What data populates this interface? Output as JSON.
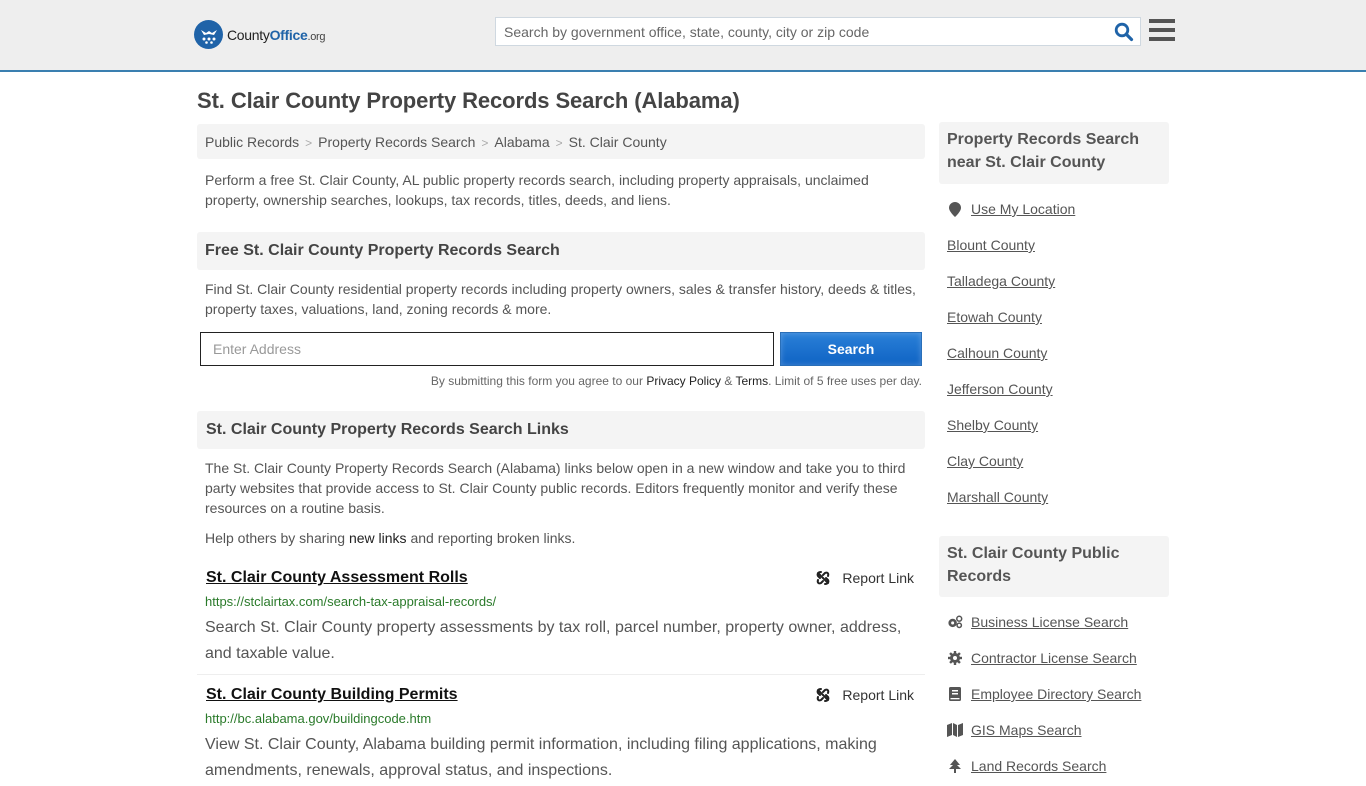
{
  "header": {
    "logo": {
      "county": "County",
      "office": "Office",
      "org": ".org"
    },
    "search_placeholder": "Search by government office, state, county, city or zip code",
    "search_value": ""
  },
  "page_title": "St. Clair County Property Records Search (Alabama)",
  "breadcrumb": [
    "Public Records",
    "Property Records Search",
    "Alabama",
    "St. Clair County"
  ],
  "intro": "Perform a free St. Clair County, AL public property records search, including property appraisals, unclaimed property, ownership searches, lookups, tax records, titles, deeds, and liens.",
  "free_search": {
    "heading": "Free St. Clair County Property Records Search",
    "description": "Find St. Clair County residential property records including property owners, sales & transfer history, deeds & titles, property taxes, valuations, land, zoning records & more.",
    "address_placeholder": "Enter Address",
    "address_value": "",
    "button_label": "Search",
    "disclaimer": {
      "prefix": "By submitting this form you agree to our ",
      "privacy": "Privacy Policy",
      "amp": " & ",
      "terms": "Terms",
      "suffix": ". Limit of 5 free uses per day."
    }
  },
  "links_section": {
    "heading": "St. Clair County Property Records Search Links",
    "description": "The St. Clair County Property Records Search (Alabama) links below open in a new window and take you to third party websites that provide access to St. Clair County public records. Editors frequently monitor and verify these resources on a routine basis.",
    "help": {
      "prefix": "Help others by sharing ",
      "link": "new links",
      "suffix": " and reporting broken links."
    },
    "report_label": "Report Link",
    "items": [
      {
        "title": "St. Clair County Assessment Rolls",
        "url": "https://stclairtax.com/search-tax-appraisal-records/",
        "description": "Search St. Clair County property assessments by tax roll, parcel number, property owner, address, and taxable value."
      },
      {
        "title": "St. Clair County Building Permits",
        "url": "http://bc.alabama.gov/buildingcode.htm",
        "description": "View St. Clair County, Alabama building permit information, including filing applications, making amendments, renewals, approval status, and inspections."
      }
    ]
  },
  "sidebar": {
    "nearby": {
      "heading": "Property Records Search near St. Clair County",
      "use_location": "Use My Location",
      "counties": [
        "Blount County",
        "Talladega County",
        "Etowah County",
        "Calhoun County",
        "Jefferson County",
        "Shelby County",
        "Clay County",
        "Marshall County"
      ]
    },
    "public_records": {
      "heading": "St. Clair County Public Records",
      "items": [
        {
          "label": "Business License Search",
          "icon": "cogs-icon"
        },
        {
          "label": "Contractor License Search",
          "icon": "gear-icon"
        },
        {
          "label": "Employee Directory Search",
          "icon": "book-icon"
        },
        {
          "label": "GIS Maps Search",
          "icon": "map-icon"
        },
        {
          "label": "Land Records Search",
          "icon": "tree-icon"
        }
      ]
    }
  },
  "colors": {
    "accent": "#1f63a8",
    "header_border": "#3a7fb0",
    "url_green": "#2a7a2a",
    "button_blue": "#1a6fcc"
  }
}
